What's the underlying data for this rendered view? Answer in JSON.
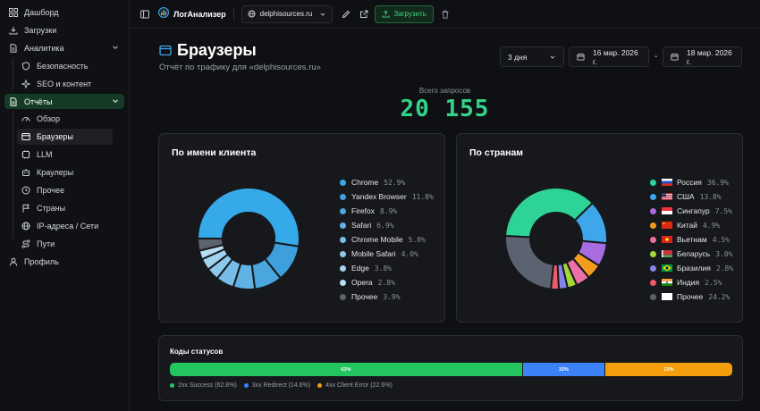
{
  "sidebar": {
    "items": [
      {
        "label": "Дашборд",
        "icon": "dashboard-icon"
      },
      {
        "label": "Загрузки",
        "icon": "download-icon"
      },
      {
        "label": "Аналитика",
        "icon": "analytics-icon"
      },
      {
        "label": "Безопасность",
        "icon": "shield-icon"
      },
      {
        "label": "SEO и контент",
        "icon": "sparkle-icon"
      },
      {
        "label": "Отчёты",
        "icon": "report-icon"
      },
      {
        "label": "Обзор",
        "icon": "gauge-icon"
      },
      {
        "label": "Браузеры",
        "icon": "browser-icon"
      },
      {
        "label": "LLM",
        "icon": "llm-icon"
      },
      {
        "label": "Краулеры",
        "icon": "crawler-icon"
      },
      {
        "label": "Прочее",
        "icon": "clock-icon"
      },
      {
        "label": "Страны",
        "icon": "flag-icon"
      },
      {
        "label": "IP-адреса / Сети",
        "icon": "globe-icon"
      },
      {
        "label": "Пути",
        "icon": "route-icon"
      },
      {
        "label": "Профиль",
        "icon": "user-icon"
      }
    ]
  },
  "header": {
    "app_name": "ЛогАнализер",
    "site": "delphisources.ru",
    "upload_label": "Загрузить"
  },
  "page": {
    "title": "Браузеры",
    "subtitle": "Отчёт по трафику для «delphisources.ru»",
    "range_option": "3 дня",
    "date_from": "16 мар. 2026 г.",
    "date_sep": "-",
    "date_to": "18 мар. 2026 г.",
    "total_label": "Всего запросов",
    "total_value": "20 155"
  },
  "colors": {
    "accent": "#33d489",
    "active_group_bg": "#143b25"
  },
  "chart_data": [
    {
      "type": "pie",
      "title": "По имени клиента",
      "categories": [
        "Chrome",
        "Yandex Browser",
        "Firefox",
        "Safari",
        "Chrome Mobile",
        "Mobile Safari",
        "Edge",
        "Opera",
        "Прочее"
      ],
      "values": [
        52.9,
        11.8,
        8.9,
        6.9,
        5.8,
        4.0,
        3.8,
        2.8,
        3.9
      ],
      "labels": [
        "52.9%",
        "11.8%",
        "8.9%",
        "6.9%",
        "5.8%",
        "4.0%",
        "3.8%",
        "2.8%",
        "3.9%"
      ],
      "colors": [
        "#36a9e8",
        "#3d9fdc",
        "#4aa6dd",
        "#5fb2e3",
        "#76bde7",
        "#8cc8eb",
        "#a2d3ef",
        "#b8def3",
        "#5c6370"
      ],
      "legend": "right"
    },
    {
      "type": "pie",
      "title": "По странам",
      "categories": [
        "Россия",
        "США",
        "Сингапур",
        "Китай",
        "Вьетнам",
        "Беларусь",
        "Бразилия",
        "Индия",
        "Прочее"
      ],
      "values": [
        36.9,
        13.8,
        7.5,
        4.9,
        4.5,
        3.0,
        2.8,
        2.5,
        24.2
      ],
      "labels": [
        "36.9%",
        "13.8%",
        "7.5%",
        "4.9%",
        "4.5%",
        "3.0%",
        "2.8%",
        "2.5%",
        "24.2%"
      ],
      "colors": [
        "#2ed497",
        "#3ea6ea",
        "#a86ce0",
        "#f39c1f",
        "#ee6fa8",
        "#a3d93a",
        "#8683ec",
        "#f1586a",
        "#5c6370"
      ],
      "flags": [
        "flag-ru-icon",
        "flag-us-icon",
        "flag-sg-icon",
        "flag-cn-icon",
        "flag-vn-icon",
        "flag-by-icon",
        "flag-br-icon",
        "flag-in-icon",
        "flag-blank-icon"
      ],
      "legend": "right"
    },
    {
      "type": "bar",
      "title": "Коды статусов",
      "categories": [
        "2xx Success",
        "3xx Redirect",
        "4xx Client Error"
      ],
      "values": [
        62.8,
        14.6,
        22.6
      ],
      "bar_labels": [
        "63%",
        "15%",
        "23%"
      ],
      "legend_labels": [
        "2xx Success (62.8%)",
        "3xx Redirect (14.6%)",
        "4xx Client Error (22.6%)"
      ],
      "colors": [
        "#22c55e",
        "#3b82f6",
        "#f59e0b"
      ],
      "legend": "bottom"
    }
  ]
}
